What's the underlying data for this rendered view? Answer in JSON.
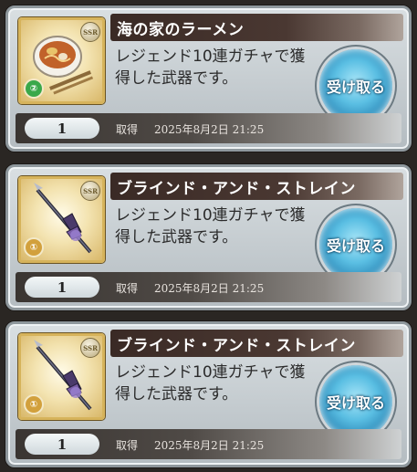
{
  "items": [
    {
      "name": "海の家のラーメン",
      "description": "レジェンド10連ガチャで獲得した武器です。",
      "quantity": "1",
      "acquired_label": "取得",
      "acquired_date": "2025年8月2日 21:25",
      "claim_label": "受け取る",
      "rarity": "SSR",
      "icon": "ramen-bowl-icon",
      "element_color": "#3aa84a"
    },
    {
      "name": "ブラインド・アンド・ストレイン",
      "description": "レジェンド10連ガチャで獲得した武器です。",
      "quantity": "1",
      "acquired_label": "取得",
      "acquired_date": "2025年8月2日 21:25",
      "claim_label": "受け取る",
      "rarity": "SSR",
      "icon": "halberd-weapon-icon",
      "element_color": "#d2a03c"
    },
    {
      "name": "ブラインド・アンド・ストレイン",
      "description": "レジェンド10連ガチャで獲得した武器です。",
      "quantity": "1",
      "acquired_label": "取得",
      "acquired_date": "2025年8月2日 21:25",
      "claim_label": "受け取る",
      "rarity": "SSR",
      "icon": "halberd-weapon-icon",
      "element_color": "#d2a03c"
    }
  ]
}
